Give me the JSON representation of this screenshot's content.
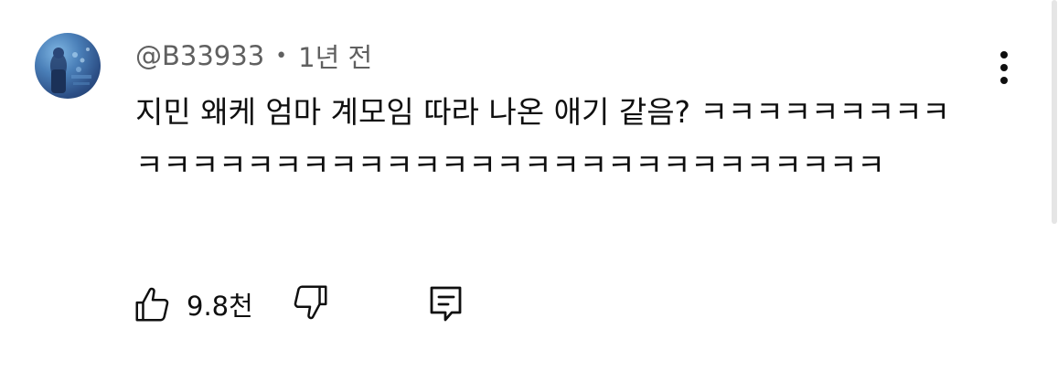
{
  "comment": {
    "author": "@B33933",
    "separator": "•",
    "timestamp": "1년 전",
    "text": "지민 왜케 엄마 계모임 따라 나온 애기 같음? ㅋㅋㅋㅋㅋㅋㅋㅋㅋㅋㅋㅋㅋㅋㅋㅋㅋㅋㅋㅋㅋㅋㅋㅋㅋㅋㅋㅋㅋㅋㅋㅋㅋㅋㅋㅋ",
    "like_count": "9.8천"
  },
  "icons": {
    "avatar": "avatar-image",
    "more": "more-vert-icon",
    "like": "thumbs-up-icon",
    "dislike": "thumbs-down-icon",
    "reply": "comment-reply-icon"
  },
  "colors": {
    "text_primary": "#0f0f0f",
    "text_secondary": "#606060",
    "background": "#ffffff",
    "scrollbar": "#e5e5e5"
  }
}
